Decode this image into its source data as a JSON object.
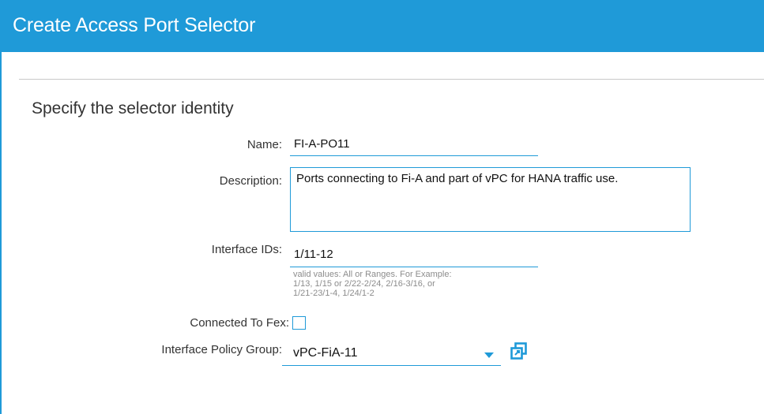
{
  "dialog": {
    "title": "Create Access Port Selector"
  },
  "section": {
    "title": "Specify the selector identity"
  },
  "fields": {
    "name": {
      "label": "Name:",
      "value": "FI-A-PO11"
    },
    "description": {
      "label": "Description:",
      "value": "Ports connecting to Fi-A and part of vPC for HANA traffic use."
    },
    "interface_ids": {
      "label": "Interface IDs:",
      "value": "1/11-12",
      "help_lines": [
        "valid values: All or Ranges. For Example:",
        "1/13, 1/15 or 2/22-2/24, 2/16-3/16, or",
        "1/21-23/1-4, 1/24/1-2"
      ]
    },
    "connected_to_fex": {
      "label": "Connected To Fex:",
      "checked": false
    },
    "interface_policy_group": {
      "label": "Interface Policy Group:",
      "value": "vPC-FiA-11",
      "icon": "chevron-down-icon",
      "action_icon": "open-in-new-icon"
    }
  },
  "colors": {
    "accent": "#1f9ad8",
    "header_bg": "#1f9ad8",
    "help_text": "#8c8c8c"
  }
}
